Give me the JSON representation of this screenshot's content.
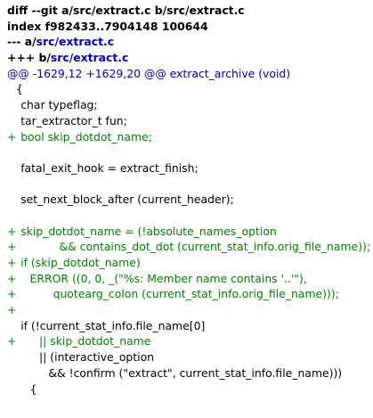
{
  "colors": {
    "header_text": "#000000",
    "header_path": "#0000cc",
    "hunk": "#0000cc",
    "added": "#008000",
    "context": "#000000",
    "background": "#ffffff"
  },
  "header": {
    "diff_line": "diff --git a/src/extract.c b/src/extract.c",
    "index_line": "index f982433..7904148 100644",
    "old_prefix": "--- a/",
    "old_path": "src/extract.c",
    "new_prefix": "+++ b/",
    "new_path": "src/extract.c"
  },
  "hunk": "@@ -1629,12 +1629,20 @@ extract_archive (void)",
  "lines": [
    {
      "type": "context",
      "marker": "",
      "indent": 0,
      "text": "{"
    },
    {
      "type": "context",
      "marker": "",
      "indent": 1,
      "text": "char typeflag;"
    },
    {
      "type": "context",
      "marker": "",
      "indent": 1,
      "text": "tar_extractor_t fun;"
    },
    {
      "type": "added",
      "marker": "+",
      "indent": 1,
      "text": "bool skip_dotdot_name;"
    },
    {
      "type": "context",
      "marker": "",
      "indent": 0,
      "text": ""
    },
    {
      "type": "context",
      "marker": "",
      "indent": 1,
      "text": "fatal_exit_hook = extract_finish;"
    },
    {
      "type": "context",
      "marker": "",
      "indent": 0,
      "text": ""
    },
    {
      "type": "context",
      "marker": "",
      "indent": 1,
      "text": "set_next_block_after (current_header);"
    },
    {
      "type": "context",
      "marker": "",
      "indent": 0,
      "text": ""
    },
    {
      "type": "added",
      "marker": "+",
      "indent": 1,
      "text": "skip_dotdot_name = (!absolute_names_option"
    },
    {
      "type": "added",
      "marker": "+",
      "indent": 14,
      "text": "&& contains_dot_dot (current_stat_info.orig_file_name));"
    },
    {
      "type": "added",
      "marker": "+",
      "indent": 1,
      "text": "if (skip_dotdot_name)"
    },
    {
      "type": "added",
      "marker": "+",
      "indent": 3,
      "text": "ERROR ((0, 0, _(\"%s: Member name contains '..'\"),"
    },
    {
      "type": "added",
      "marker": "+",
      "indent": 8,
      "text": "quotearg_colon (current_stat_info.orig_file_name)));"
    },
    {
      "type": "added",
      "marker": "+",
      "indent": 0,
      "text": ""
    },
    {
      "type": "context",
      "marker": "",
      "indent": 1,
      "text": "if (!current_stat_info.file_name[0]"
    },
    {
      "type": "added",
      "marker": "+",
      "indent": 5,
      "text": "|| skip_dotdot_name"
    },
    {
      "type": "context",
      "marker": "",
      "indent": 5,
      "text": "|| (interactive_option"
    },
    {
      "type": "context",
      "marker": "",
      "indent": 7,
      "text": "&& !confirm (\"extract\", current_stat_info.file_name)))"
    },
    {
      "type": "context",
      "marker": "",
      "indent": 3,
      "text": "{"
    }
  ]
}
